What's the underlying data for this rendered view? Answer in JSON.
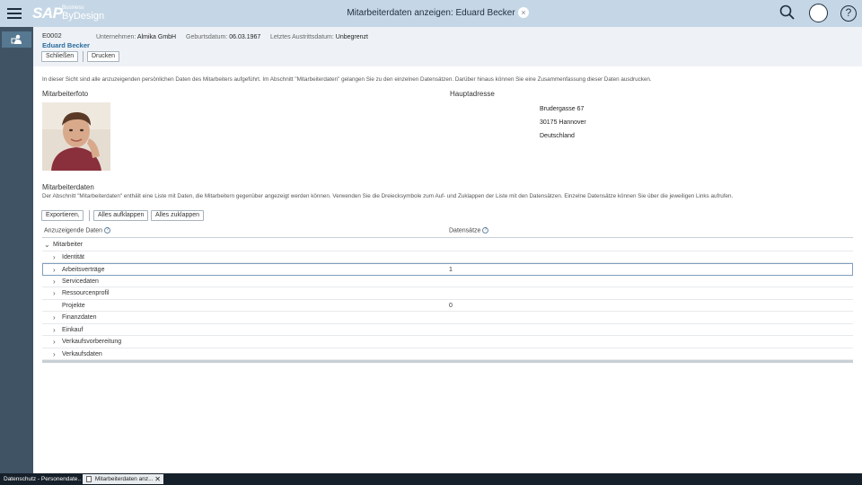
{
  "shell": {
    "logo_sap": "SAP",
    "logo_business": "Business",
    "logo_bydesign": "ByDesign",
    "title": "Mitarbeiterdaten anzeigen: Eduard Becker",
    "close_symbol": "×",
    "help_symbol": "?"
  },
  "header": {
    "employee_id": "E0002",
    "employee_name": "Eduard Becker",
    "company_label": "Unternehmen:",
    "company_value": "Almika GmbH",
    "birth_label": "Geburtsdatum:",
    "birth_value": "06.03.1967",
    "exit_label": "Letztes Austrittsdatum:",
    "exit_value": "Unbegrenzt",
    "close_btn": "Schließen",
    "print_btn": "Drucken"
  },
  "intro_text": "In dieser Sicht sind alle anzuzeigenden persönlichen Daten des Mitarbeiters aufgeführt. Im Abschnitt \"Mitarbeiterdaten\" gelangen Sie zu den einzelnen Datensätzen. Darüber hinaus können Sie eine Zusammenfassung dieser Daten ausdrucken.",
  "photo_section": {
    "title": "Mitarbeiterfoto"
  },
  "address_section": {
    "title": "Hauptadresse",
    "street": "Brudergasse 67",
    "city": "30175 Hannover",
    "country": "Deutschland"
  },
  "data_section": {
    "title": "Mitarbeiterdaten",
    "description": "Der Abschnitt \"Mitarbeiterdaten\" enthält eine Liste mit Daten, die Mitarbeitern gegenüber angezeigt werden können. Verwenden Sie die Dreiecksymbole zum Auf- und Zuklappen der Liste mit den Datensätzen. Einzelne Datensätze können Sie über die jeweiligen Links aufrufen.",
    "export_btn": "Exportieren",
    "expand_all_btn": "Alles aufklappen",
    "collapse_all_btn": "Alles zuklappen",
    "col1_header": "Anzuzeigende Daten",
    "col2_header": "Datensätze",
    "rows": [
      {
        "label": "Mitarbeiter",
        "value": "",
        "caret": "⌄"
      },
      {
        "label": "Identität",
        "value": "",
        "caret": "›"
      },
      {
        "label": "Arbeitsverträge",
        "value": "1",
        "caret": "›"
      },
      {
        "label": "Servicedaten",
        "value": "",
        "caret": "›"
      },
      {
        "label": "Ressourcenprofil",
        "value": "",
        "caret": "›"
      },
      {
        "label": "Projekte",
        "value": "0",
        "caret": ""
      },
      {
        "label": "Finanzdaten",
        "value": "",
        "caret": "›"
      },
      {
        "label": "Einkauf",
        "value": "",
        "caret": "›"
      },
      {
        "label": "Verkaufsvorbereitung",
        "value": "",
        "caret": "›"
      },
      {
        "label": "Verkaufsdaten",
        "value": "",
        "caret": "›"
      }
    ]
  },
  "taskbar": {
    "task1": "Datenschutz - Personendate...",
    "task2": "Mitarbeiterdaten anz...",
    "task2_close": "✕"
  },
  "colors": {
    "shell_bg": "#c5d7e6",
    "nav_bg": "#3f5365",
    "link_blue": "#2a6c9d",
    "taskbar_bg": "#16202a"
  }
}
